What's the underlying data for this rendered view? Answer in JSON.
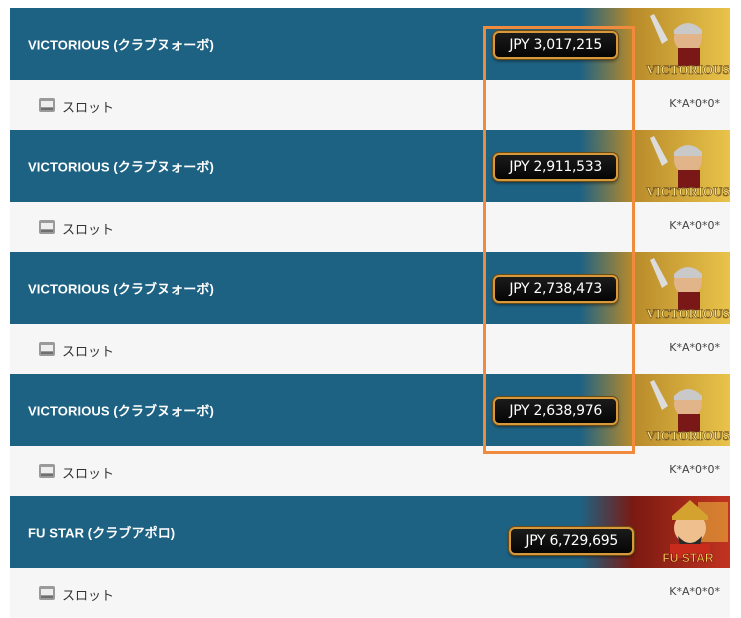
{
  "entries": [
    {
      "title": "VICTORIOUS (クラブヌォーボ)",
      "jackpot": "JPY 3,017,215",
      "category": "スロット",
      "winner": "K*A*0*0*",
      "thumb": "victorious"
    },
    {
      "title": "VICTORIOUS (クラブヌォーボ)",
      "jackpot": "JPY 2,911,533",
      "category": "スロット",
      "winner": "K*A*0*0*",
      "thumb": "victorious"
    },
    {
      "title": "VICTORIOUS (クラブヌォーボ)",
      "jackpot": "JPY 2,738,473",
      "category": "スロット",
      "winner": "K*A*0*0*",
      "thumb": "victorious"
    },
    {
      "title": "VICTORIOUS (クラブヌォーボ)",
      "jackpot": "JPY 2,638,976",
      "category": "スロット",
      "winner": "K*A*0*0*",
      "thumb": "victorious"
    },
    {
      "title": "FU STAR (クラブアポロ)",
      "jackpot": "JPY 6,729,695",
      "category": "スロット",
      "winner": "K*A*0*0*",
      "thumb": "fustar"
    }
  ],
  "thumb_text": {
    "victorious": "VICTORIOUS",
    "fustar": "FU STAR"
  },
  "colors": {
    "header": "#1e6283",
    "row": "#f6f6f6",
    "highlight": "#f08a3c",
    "badge_border": "#d79a3a"
  }
}
